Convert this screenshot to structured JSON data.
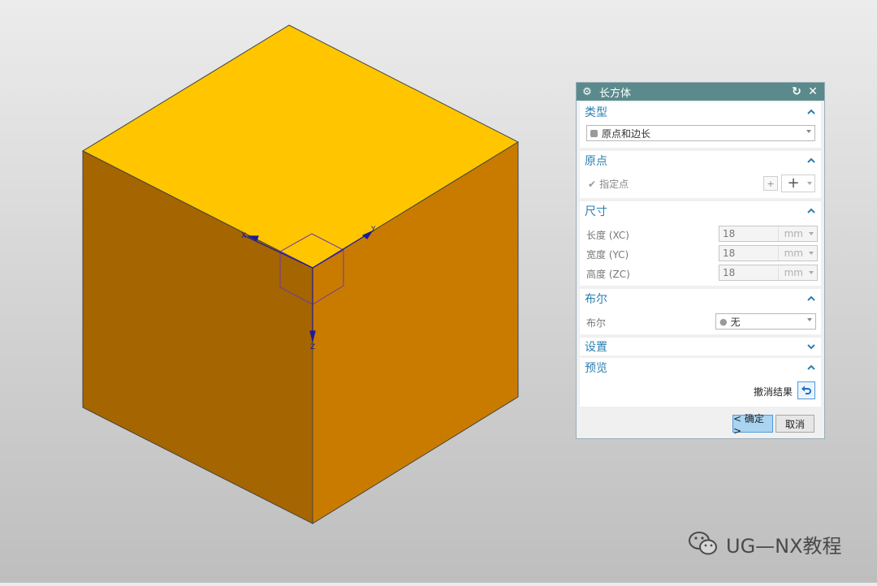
{
  "viewport": {
    "cube_top_color": "#ffc600",
    "cube_left_color": "#a56500",
    "cube_right_color": "#c97b00",
    "axis_color": "#1a1a9a",
    "preview_box_color": "#6b3aa6",
    "axis_labels": {
      "x": "X",
      "y": "Y",
      "z": "Z"
    }
  },
  "dialog": {
    "title": "长方体",
    "type_section": {
      "label": "类型",
      "selected": "原点和边长"
    },
    "origin_section": {
      "label": "原点",
      "specify_point": "指定点"
    },
    "dims_section": {
      "label": "尺寸",
      "rows": [
        {
          "label": "长度 (XC)",
          "value": "18",
          "unit": "mm"
        },
        {
          "label": "宽度 (YC)",
          "value": "18",
          "unit": "mm"
        },
        {
          "label": "高度 (ZC)",
          "value": "18",
          "unit": "mm"
        }
      ]
    },
    "boolean_section": {
      "label": "布尔",
      "row_label": "布尔",
      "selected": "无"
    },
    "settings_section": {
      "label": "设置"
    },
    "preview_section": {
      "label": "预览",
      "undo_label": "撤消结果"
    },
    "ok_label": "< 确定 >",
    "cancel_label": "取消"
  },
  "watermark": {
    "text": "UG—NX教程"
  }
}
